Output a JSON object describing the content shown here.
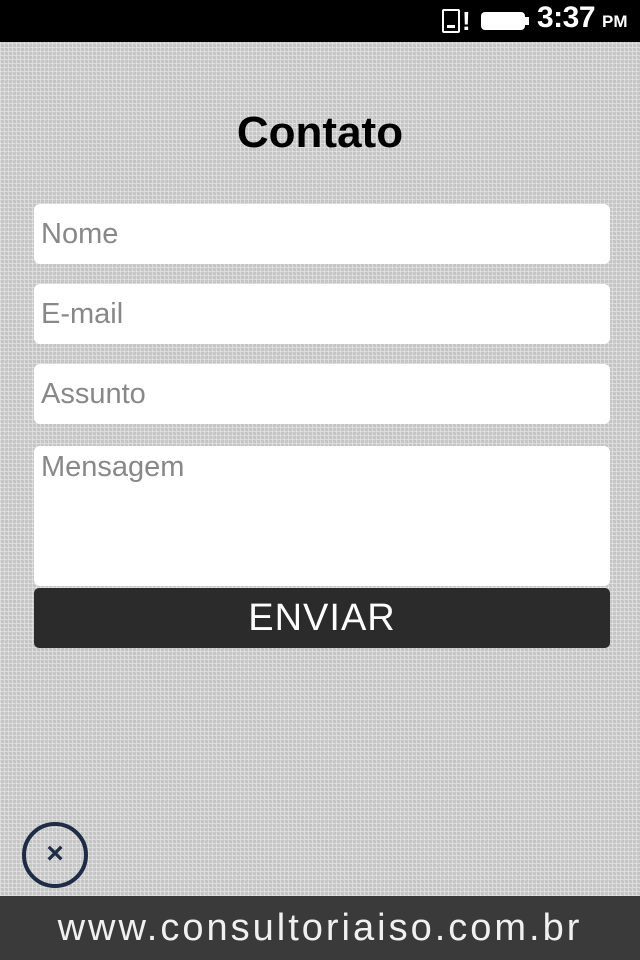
{
  "status_bar": {
    "time": "3:37",
    "ampm": "PM",
    "icons": [
      "sim-card-icon",
      "alert-icon",
      "battery-icon"
    ]
  },
  "page": {
    "title": "Contato"
  },
  "form": {
    "name_placeholder": "Nome",
    "email_placeholder": "E-mail",
    "subject_placeholder": "Assunto",
    "message_placeholder": "Mensagem",
    "submit_label": "ENVIAR"
  },
  "close": {
    "symbol": "×",
    "icon": "close-icon"
  },
  "footer": {
    "url": "www.consultoriaiso.com.br"
  },
  "colors": {
    "status_bar": "#000000",
    "button": "#2b2b2b",
    "footer": "#3a3a3a",
    "close_ring": "#1e2d45"
  }
}
